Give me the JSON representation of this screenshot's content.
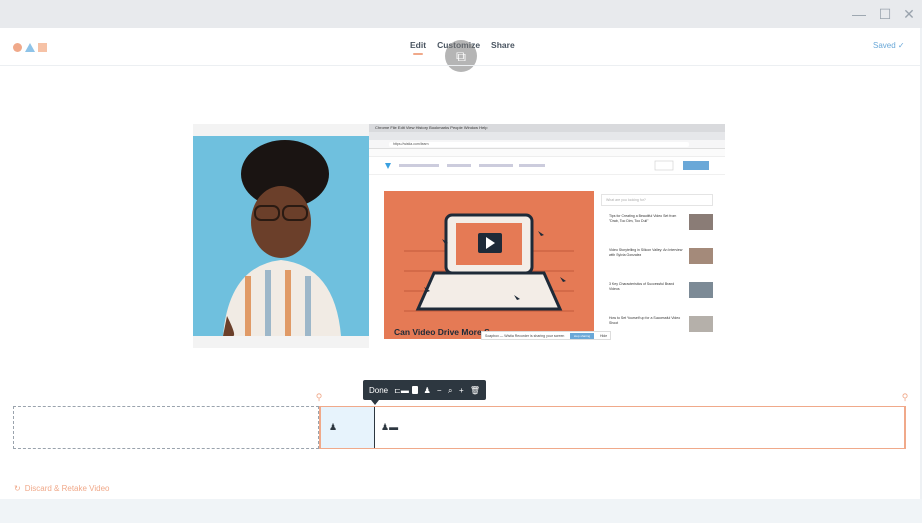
{
  "window": {
    "minimize_icon": "—",
    "maximize_icon": "☐",
    "close_icon": "✕"
  },
  "nav": {
    "tabs": [
      {
        "label": "Edit"
      },
      {
        "label": "Customize"
      },
      {
        "label": "Share"
      }
    ],
    "active_tab": "Edit"
  },
  "status": {
    "saved_label": "Saved ✓"
  },
  "preview": {
    "browser": {
      "menu_text": "Chrome  File  Edit  View  History  Bookmarks  People  Window  Help",
      "url": "https://wistia.com/learn",
      "search_placeholder": "What are you looking for?",
      "hero_title": "Can Video Drive More S...",
      "sidebar_items": [
        "Tips for Creating a Beautiful Video Set from \"Drab, Too Dim, Too Dull\"",
        "Video Storytelling in Silicon Valley: An Interview with Sylvia Gonzalez",
        "3 Key Characteristics of Successful Brand Videos",
        "How to Set Yourself up for a Successful Video Shoot"
      ],
      "toast_text": "Soapbox — Wistia Recorder is sharing your screen",
      "toast_button": "stop sharing",
      "toast_hide": "Hide"
    }
  },
  "toolbar": {
    "done_label": "Done"
  },
  "discard": {
    "label": "Discard & Retake Video"
  },
  "colors": {
    "accent": "#f0a98a",
    "link": "#6aa8d8",
    "toolbar_bg": "#2d3740"
  }
}
